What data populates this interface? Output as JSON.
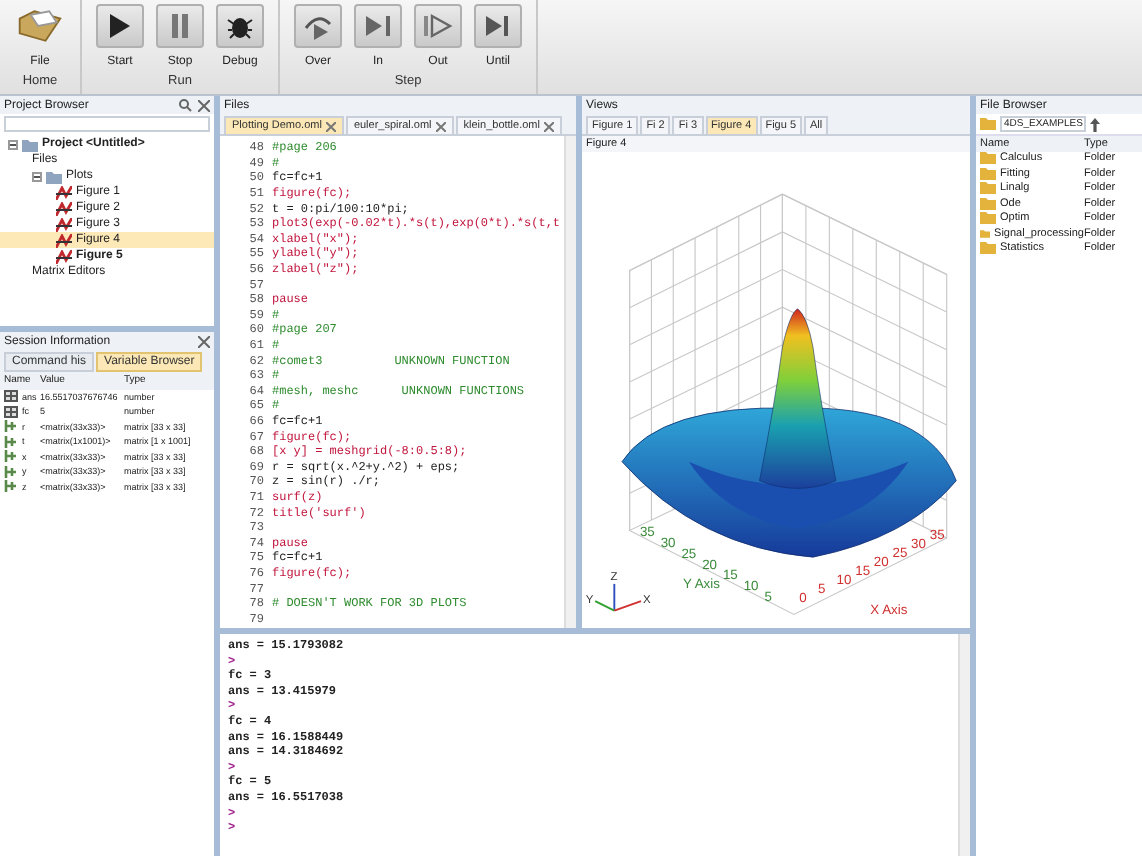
{
  "ribbon": {
    "groups": [
      {
        "label": "Home",
        "buttons": [
          {
            "label": "File",
            "kind": "file"
          }
        ]
      },
      {
        "label": "Run",
        "buttons": [
          {
            "label": "Start",
            "kind": "start"
          },
          {
            "label": "Stop",
            "kind": "stop"
          },
          {
            "label": "Debug",
            "kind": "debug"
          }
        ]
      },
      {
        "label": "Step",
        "buttons": [
          {
            "label": "Over",
            "kind": "over"
          },
          {
            "label": "In",
            "kind": "in"
          },
          {
            "label": "Out",
            "kind": "out"
          },
          {
            "label": "Until",
            "kind": "until"
          }
        ]
      }
    ]
  },
  "project_browser": {
    "title": "Project Browser",
    "tree": [
      {
        "label": "Project <Untitled>",
        "kind": "project",
        "expanded": true,
        "selected": false,
        "children": [
          {
            "label": "Files",
            "kind": "node",
            "selected": false
          },
          {
            "label": "Plots",
            "kind": "folder",
            "expanded": true,
            "selected": false,
            "children": [
              {
                "label": "Figure 1",
                "kind": "figure",
                "active": false,
                "selected": false
              },
              {
                "label": "Figure 2",
                "kind": "figure",
                "active": false,
                "selected": false
              },
              {
                "label": "Figure 3",
                "kind": "figure",
                "active": false,
                "selected": false
              },
              {
                "label": "Figure 4",
                "kind": "figure",
                "active": false,
                "selected": true
              },
              {
                "label": "Figure 5",
                "kind": "figure",
                "active": true,
                "selected": false
              }
            ]
          },
          {
            "label": "Matrix Editors",
            "kind": "node",
            "selected": false
          }
        ]
      }
    ]
  },
  "session": {
    "title": "Session Information",
    "tabs": [
      {
        "label": "Command his",
        "selected": false
      },
      {
        "label": "Variable Browser",
        "selected": true
      }
    ],
    "columns": [
      "Name",
      "Value",
      "Type"
    ],
    "rows": [
      {
        "name": "ans",
        "value": "16.5517037676746",
        "type": "number",
        "kind": "scalar"
      },
      {
        "name": "fc",
        "value": "5",
        "type": "number",
        "kind": "scalar"
      },
      {
        "name": "r",
        "value": "<matrix(33x33)>",
        "type": "matrix [33 x 33]",
        "kind": "matrix"
      },
      {
        "name": "t",
        "value": "<matrix(1x1001)>",
        "type": "matrix [1 x 1001]",
        "kind": "matrix"
      },
      {
        "name": "x",
        "value": "<matrix(33x33)>",
        "type": "matrix [33 x 33]",
        "kind": "matrix"
      },
      {
        "name": "y",
        "value": "<matrix(33x33)>",
        "type": "matrix [33 x 33]",
        "kind": "matrix"
      },
      {
        "name": "z",
        "value": "<matrix(33x33)>",
        "type": "matrix [33 x 33]",
        "kind": "matrix"
      }
    ]
  },
  "files": {
    "title": "Files",
    "tabs": [
      {
        "label": "Plotting Demo.oml",
        "selected": true
      },
      {
        "label": "euler_spiral.oml",
        "selected": false
      },
      {
        "label": "klein_bottle.oml",
        "selected": false
      }
    ],
    "lines": [
      {
        "n": "48",
        "text": "#page 206",
        "kind": "comment"
      },
      {
        "n": "49",
        "text": "#",
        "kind": "comment"
      },
      {
        "n": "50",
        "text": "fc=fc+1",
        "kind": "plain"
      },
      {
        "n": "51",
        "text": "figure(fc);",
        "kind": "call"
      },
      {
        "n": "52",
        "text": "t = 0:pi/100:10*pi;",
        "kind": "plain"
      },
      {
        "n": "53",
        "text": "plot3(exp(-0.02*t).*s(t),exp(0*t).*s(t,t",
        "kind": "call"
      },
      {
        "n": "54",
        "text": "xlabel(\"x\");",
        "kind": "call"
      },
      {
        "n": "55",
        "text": "ylabel(\"y\");",
        "kind": "call"
      },
      {
        "n": "56",
        "text": "zlabel(\"z\");",
        "kind": "call"
      },
      {
        "n": "57"
      },
      {
        "n": "58",
        "text": "pause",
        "kind": "call"
      },
      {
        "n": "59",
        "text": "#",
        "kind": "comment"
      },
      {
        "n": "60",
        "text": "#page 207",
        "kind": "comment"
      },
      {
        "n": "61",
        "text": "#",
        "kind": "comment"
      },
      {
        "n": "62",
        "text": "#comet3          UNKNOWN FUNCTION",
        "kind": "comment"
      },
      {
        "n": "63",
        "text": "#",
        "kind": "comment"
      },
      {
        "n": "64",
        "text": "#mesh, meshc      UNKNOWN FUNCTIONS",
        "kind": "comment"
      },
      {
        "n": "65",
        "text": "#",
        "kind": "comment"
      },
      {
        "n": "66",
        "text": "fc=fc+1",
        "kind": "plain"
      },
      {
        "n": "67",
        "text": "figure(fc);",
        "kind": "call"
      },
      {
        "n": "68",
        "text": "[x y] = meshgrid(-8:0.5:8);",
        "kind": "call"
      },
      {
        "n": "69",
        "text": "r = sqrt(x.^2+y.^2) + eps;",
        "kind": "plain"
      },
      {
        "n": "70",
        "text": "z = sin(r) ./r;",
        "kind": "plain"
      },
      {
        "n": "71",
        "text": "surf(z)",
        "kind": "call"
      },
      {
        "n": "72",
        "text": "title('surf')",
        "kind": "call"
      },
      {
        "n": "73"
      },
      {
        "n": "74",
        "text": "pause",
        "kind": "call"
      },
      {
        "n": "75",
        "text": "fc=fc+1",
        "kind": "plain"
      },
      {
        "n": "76",
        "text": "figure(fc);",
        "kind": "call"
      },
      {
        "n": "77"
      },
      {
        "n": "78",
        "text": "# DOESN'T WORK FOR 3D PLOTS",
        "kind": "comment"
      },
      {
        "n": "79"
      }
    ]
  },
  "views": {
    "title": "Views",
    "tabs": [
      {
        "label": "Figure 1",
        "selected": false
      },
      {
        "label": "Fi 2",
        "selected": false
      },
      {
        "label": "Fi 3",
        "selected": false
      },
      {
        "label": "Figure 4",
        "selected": true
      },
      {
        "label": "Figu 5",
        "selected": false
      },
      {
        "label": "All",
        "selected": false
      }
    ],
    "figure_title": "Figure 4",
    "y_ticks": [
      "35",
      "30",
      "25",
      "20",
      "15",
      "10",
      "5"
    ],
    "x_ticks": [
      "0",
      "5",
      "10",
      "15",
      "20",
      "25",
      "30",
      "35"
    ],
    "y_label": "Y Axis",
    "x_label": "X Axis",
    "triad": {
      "z": "Z",
      "y": "Y",
      "x": "X"
    }
  },
  "console": {
    "lines": [
      {
        "text": "ans = 15.1793082",
        "kind": "output"
      },
      {
        "text": ">",
        "kind": "prompt"
      },
      {
        "text": "fc = 3",
        "kind": "output"
      },
      {
        "text": "ans = 13.415979",
        "kind": "output"
      },
      {
        "text": ">",
        "kind": "prompt"
      },
      {
        "text": "fc = 4",
        "kind": "output"
      },
      {
        "text": "ans = 16.1588449",
        "kind": "output"
      },
      {
        "text": "ans = 14.3184692",
        "kind": "output"
      },
      {
        "text": ">",
        "kind": "prompt"
      },
      {
        "text": "fc = 5",
        "kind": "output"
      },
      {
        "text": "ans = 16.5517038",
        "kind": "output"
      },
      {
        "text": ">",
        "kind": "prompt"
      },
      {
        "text": ">",
        "kind": "prompt"
      }
    ]
  },
  "file_browser": {
    "title": "File Browser",
    "path": "4DS_EXAMPLES",
    "columns": [
      "Name",
      "Type"
    ],
    "rows": [
      {
        "name": "Calculus",
        "type": "Folder"
      },
      {
        "name": "Fitting",
        "type": "Folder"
      },
      {
        "name": "Linalg",
        "type": "Folder"
      },
      {
        "name": "Ode",
        "type": "Folder"
      },
      {
        "name": "Optim",
        "type": "Folder"
      },
      {
        "name": "Signal_processing",
        "type": "Folder"
      },
      {
        "name": "Statistics",
        "type": "Folder"
      }
    ]
  }
}
